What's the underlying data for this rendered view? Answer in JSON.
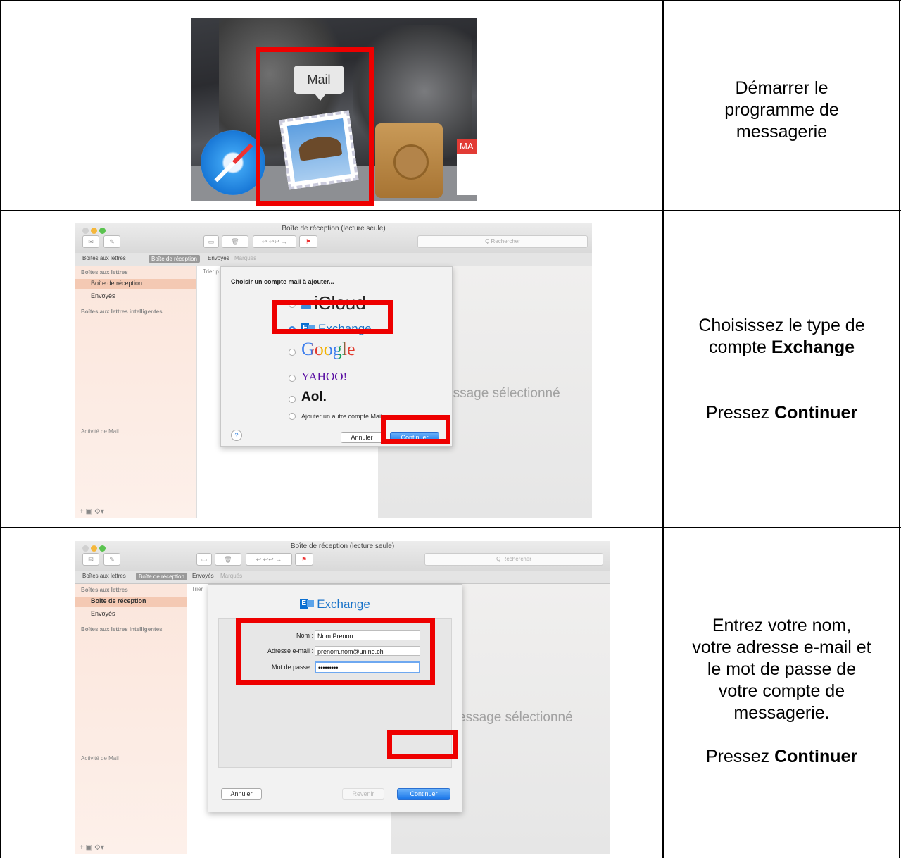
{
  "row1": {
    "tooltip": "Mail",
    "calendar_abbrev": "MA",
    "instruction_line1": "Démarrer le",
    "instruction_line2": "programme de",
    "instruction_line3": "messagerie"
  },
  "mailwindow": {
    "title": "Boîte de réception (lecture seule)",
    "search_placeholder": "Q Rechercher",
    "fav_mailboxes": "Boîtes aux lettres",
    "fav_inbox": "Boîte de réception",
    "fav_sent": "Envoyés",
    "fav_flagged": "Marqués",
    "side_header": "Boîtes aux lettres",
    "side_inbox": "Boîte de réception",
    "side_sent": "Envoyés",
    "side_smart": "Boîtes aux lettres intelligentes",
    "side_activity": "Activité de Mail",
    "sort_label_r2": "Trier p",
    "sort_label_r3": "Trier",
    "no_message": "essage sélectionné"
  },
  "row2": {
    "prompt": "Choisir un compte mail à ajouter...",
    "providers": [
      "iCloud",
      "Exchange",
      "Google",
      "YAHOO!",
      "Aol.",
      "Ajouter un autre compte Mail..."
    ],
    "help": "?",
    "cancel": "Annuler",
    "continue": "Continuer",
    "instruction_line1": "Choisissez le type de",
    "instruction_line2_pre": "compte ",
    "instruction_line2_bold": "Exchange",
    "instruction_press": "Pressez ",
    "instruction_press_bold": "Continuer"
  },
  "row3": {
    "heading": "Exchange",
    "label_name": "Nom :",
    "value_name": "Nom Prenon",
    "label_email": "Adresse e-mail :",
    "value_email": "prenom.nom@unine.ch",
    "label_password": "Mot de passe :",
    "value_password": "•••••••••",
    "cancel": "Annuler",
    "back": "Revenir",
    "continue": "Continuer",
    "instruction_line1": "Entrez votre nom,",
    "instruction_line2": "votre adresse e-mail et",
    "instruction_line3": "le mot de passe de",
    "instruction_line4": "votre compte de",
    "instruction_line5": "messagerie.",
    "instruction_press": "Pressez ",
    "instruction_press_bold": "Continuer"
  },
  "colors": {
    "highlight": "#e00000",
    "accent": "#1c78ea"
  },
  "icons": [
    "safari-icon",
    "mail-stamp-icon",
    "contacts-icon",
    "calendar-icon",
    "exchange-logo-icon",
    "mailbox-icon",
    "sent-icon",
    "help-icon"
  ]
}
